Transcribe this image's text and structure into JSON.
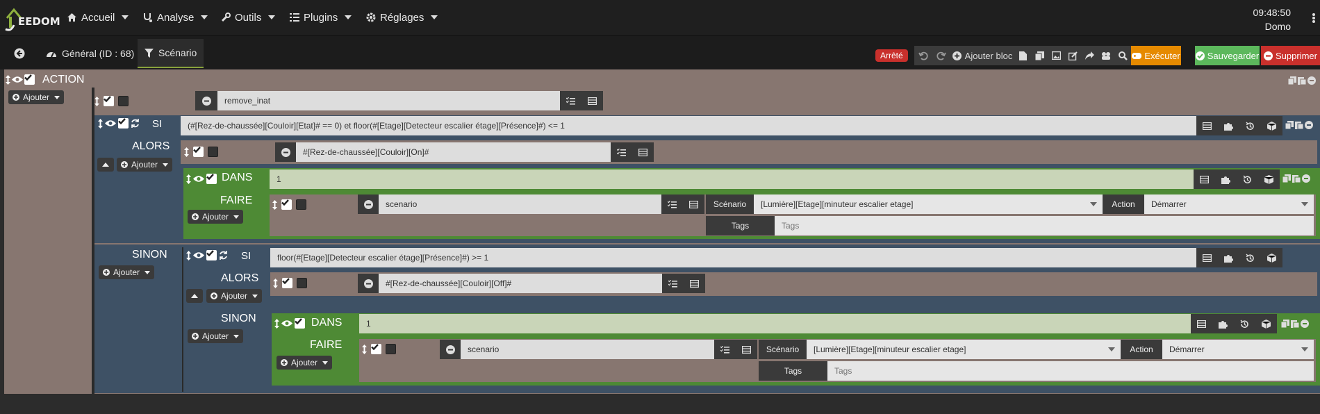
{
  "navbar": {
    "logo_text": "EEDOM",
    "menu": [
      {
        "label": "Accueil",
        "icon": "home-icon"
      },
      {
        "label": "Analyse",
        "icon": "stethoscope-icon"
      },
      {
        "label": "Outils",
        "icon": "wrench-icon"
      },
      {
        "label": "Plugins",
        "icon": "list-icon"
      },
      {
        "label": "Réglages",
        "icon": "gear-icon"
      }
    ],
    "time": "09:48:50",
    "user": "Domo"
  },
  "tabs": {
    "general": "Général (ID : 68)",
    "scenario": "Scénario"
  },
  "toolbar": {
    "status": "Arrêté",
    "add_block": "Ajouter bloc",
    "execute": "Exécuter",
    "save": "Sauvegarder",
    "delete": "Supprimer",
    "colors": {
      "execute": "#e68a00",
      "save": "#5cb85c",
      "delete": "#c9302c",
      "status": "#c9302c"
    }
  },
  "blocks": {
    "action_title": "ACTION",
    "add": "Ajouter",
    "remove_inat": "remove_inat",
    "si_label": "SI",
    "alors_label": "ALORS",
    "sinon_label": "SINON",
    "dans_label": "DANS",
    "faire_label": "FAIRE",
    "condition1": "(#[Rez-de-chaussée][Couloir][Etat]# == 0)  et floor(#[Etage][Detecteur escalier étage][Présence]#) <= 1",
    "cmd_on": "#[Rez-de-chaussée][Couloir][On]#",
    "dans_value": "1",
    "scenario_cmd": "scenario",
    "scenario_label": "Scénario",
    "scenario_value": "[Lumière][Etage][minuteur escalier etage]",
    "action_label": "Action",
    "action_value": "Démarrer",
    "tags_label": "Tags",
    "tags_placeholder": "Tags",
    "condition2": "floor(#[Etage][Detecteur escalier étage][Présence]#) >= 1",
    "cmd_off": "#[Rez-de-chaussée][Couloir][Off]#"
  }
}
